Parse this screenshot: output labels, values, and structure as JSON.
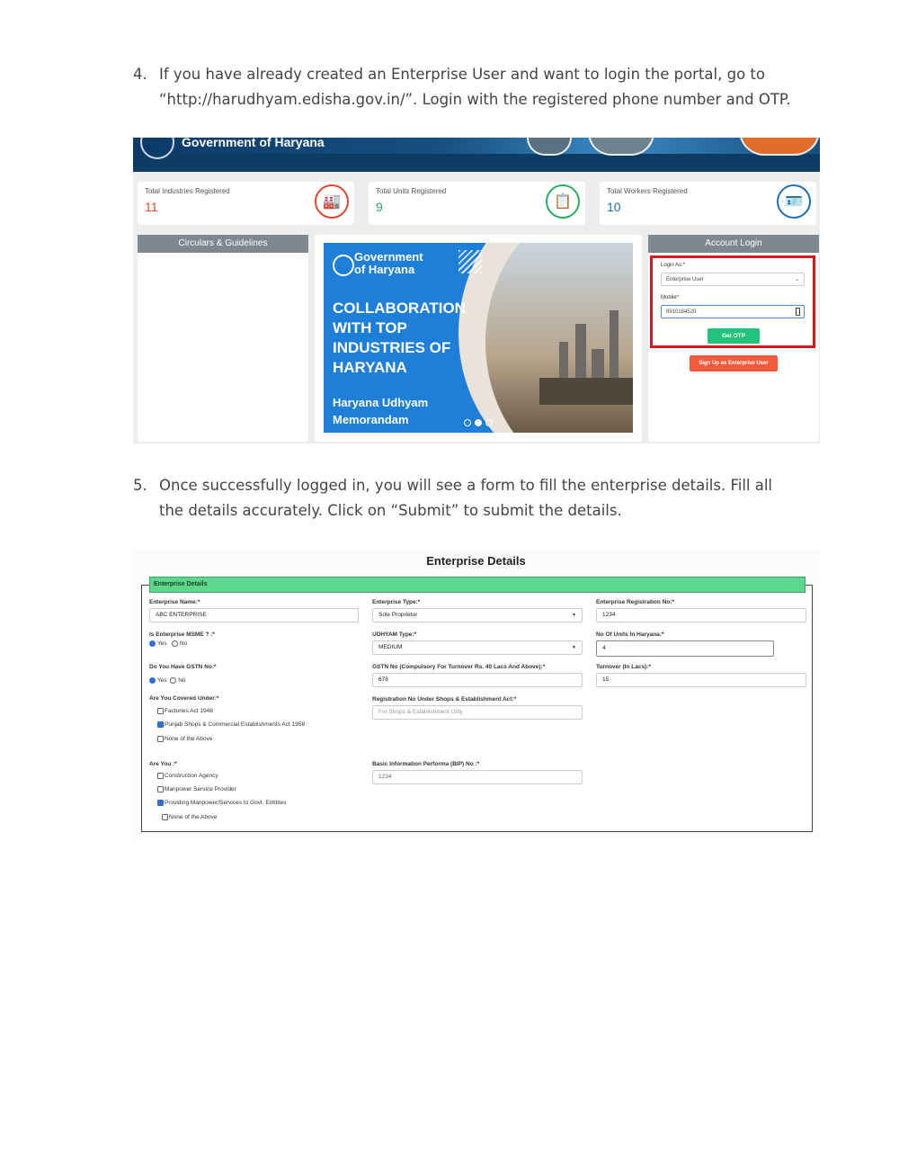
{
  "steps": [
    {
      "number": "4.",
      "text": "If you have already created an Enterprise User and want to login the portal, go to “http://harudhyam.edisha.gov.in/”. Login with the registered phone number and OTP."
    },
    {
      "number": "5.",
      "text": "Once successfully logged in, you will see a form to fill the enterprise details. Fill all the details accurately. Click on “Submit” to submit the details."
    }
  ],
  "portal": {
    "header_title": "Government of Haryana",
    "stats": [
      {
        "label": "Total Industries Registered",
        "value": "11",
        "color": "#e0472a",
        "icon": "factory-icon"
      },
      {
        "label": "Total Units Registered",
        "value": "9",
        "color": "#27ae60",
        "icon": "certificate-icon"
      },
      {
        "label": "Total Workers Registered",
        "value": "10",
        "color": "#1f6fb8",
        "icon": "worker-id-icon"
      }
    ],
    "circulars_title": "Circulars & Guidelines",
    "carousel": {
      "gov_line1": "Government",
      "gov_line2": "of Haryana",
      "headline": "COLLABORATION WITH TOP INDUSTRIES OF HARYANA",
      "sub_line1": "Haryana Udhyam",
      "sub_line2": "Memorandam"
    },
    "login": {
      "title": "Account Login",
      "login_as_label": "Login As:*",
      "login_as_value": "Enterprise User",
      "mobile_label": "Mobile*",
      "mobile_value": "9910184520",
      "otp_button": "Get OTP",
      "signup_button": "Sign Up as Enterprise User"
    }
  },
  "form": {
    "page_title": "Enterprise Details",
    "section_title": "Enterprise Details",
    "enterprise_name_label": "Enterprise Name:*",
    "enterprise_name_value": "ABC ENTERPRISE",
    "enterprise_type_label": "Enterprise Type:*",
    "enterprise_type_value": "Sole Proprietor",
    "reg_no_label": "Enterprise Registration No:*",
    "reg_no_value": "1234",
    "msme_label": "Is Enterprise MSME ? :*",
    "msme_yes": "Yes",
    "msme_no": "No",
    "udhyam_type_label": "UDHYAM Type:*",
    "udhyam_type_value": "MEDIUM",
    "units_label": "No Of Units In Haryana:*",
    "units_value": "4",
    "gstn_q_label": "Do You Have GSTN No:*",
    "gstn_yes": "Yes",
    "gstn_no": "No",
    "gstn_label": "GSTN No (Compulsory For Turnover Rs. 40 Lacs And Above):*",
    "gstn_value": "678",
    "turnover_label": "Turnover (In Lacs):*",
    "turnover_value": "15",
    "covered_label": "Are You Covered Under:*",
    "covered_options": [
      {
        "label": "Factories Act 1948",
        "checked": false
      },
      {
        "label": "Punjab Shops & Commercial Establishments Act 1958",
        "checked": true
      },
      {
        "label": "None of the Above",
        "checked": false
      }
    ],
    "shops_reg_label": "Registration No Under Shops & Establishment Act:*",
    "shops_reg_placeholder": "For Shops & Establishment Only",
    "are_you_label": "Are You :*",
    "are_you_options": [
      {
        "label": "Construction Agency",
        "checked": false
      },
      {
        "label": "Manpower Service Provider",
        "checked": false
      },
      {
        "label": "Providing Manpower/Services to Govt. Entitites",
        "checked": true
      },
      {
        "label": "None of the Above",
        "checked": false
      }
    ],
    "bip_label": "Basic Information Performa (BIP) No :*",
    "bip_value": "1234"
  }
}
